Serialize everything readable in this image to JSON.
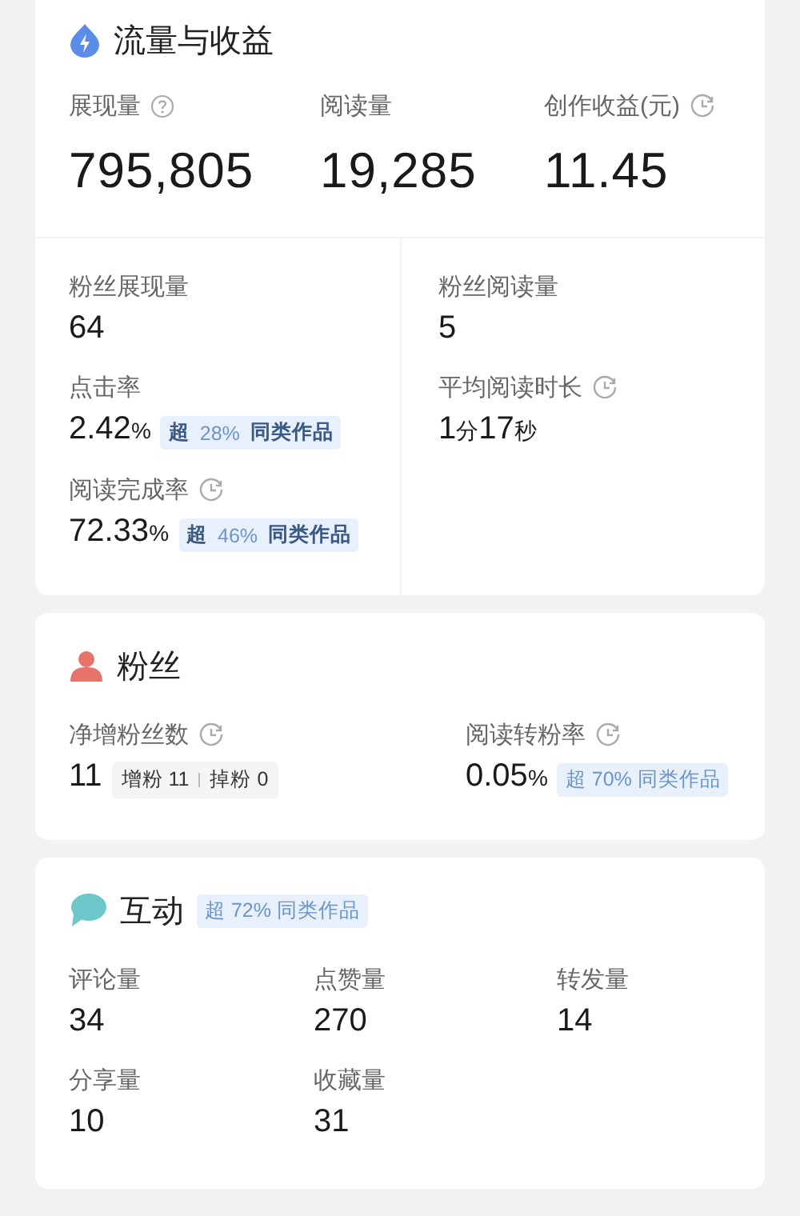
{
  "sections": [
    {
      "title": "流量与收益",
      "blocks": [
        {
          "kind": "headline",
          "items": [
            {
              "kind": "help",
              "label": "展现量",
              "value": "795,805"
            },
            {
              "kind": "plain",
              "label": "阅读量",
              "value": "19,285"
            },
            {
              "kind": "timed",
              "label": "创作收益(元)",
              "value": "11.45"
            }
          ]
        },
        {
          "kind": "split",
          "columns": [
            [
              {
                "kind": "plain",
                "label": "粉丝展现量",
                "value": "64"
              },
              {
                "kind": "plain",
                "label": "点击率",
                "value_parts": [
                  {
                    "text": "2.42",
                    "unit": false
                  },
                  {
                    "text": "%",
                    "unit": true
                  }
                ],
                "badge": "**超** 28% **同类作品**"
              },
              {
                "kind": "timed",
                "label": "阅读完成率",
                "value_parts": [
                  {
                    "text": "72.33",
                    "unit": false
                  },
                  {
                    "text": "%",
                    "unit": true
                  }
                ],
                "badge": "**超** 46% **同类作品**"
              }
            ],
            [
              {
                "kind": "plain",
                "label": "粉丝阅读量",
                "value": "5"
              },
              {
                "kind": "timed",
                "label": "平均阅读时长",
                "value_parts": [
                  {
                    "text": "1",
                    "unit": false
                  },
                  {
                    "text": "分",
                    "unit": true
                  },
                  {
                    "text": "17",
                    "unit": false
                  },
                  {
                    "text": "秒",
                    "unit": true
                  }
                ]
              }
            ]
          ]
        }
      ]
    },
    {
      "title": "粉丝",
      "blocks": [
        {
          "kind": "pair",
          "items": [
            {
              "kind": "timed",
              "label": "净增粉丝数",
              "value": "11",
              "breakdown": [
                {
                  "label": "增粉",
                  "value": "11"
                },
                {
                  "label": "掉粉",
                  "value": "0"
                }
              ]
            },
            {
              "kind": "timed",
              "label": "阅读转粉率",
              "value_parts": [
                {
                  "text": "0.05",
                  "unit": false
                },
                {
                  "text": "%",
                  "unit": true
                }
              ],
              "badge": "超 70% 同类作品"
            }
          ]
        }
      ]
    },
    {
      "title": "互动",
      "badge": "超 72% 同类作品",
      "blocks": [
        {
          "kind": "grid",
          "items": [
            {
              "kind": "plain",
              "label": "评论量",
              "value": "34"
            },
            {
              "kind": "plain",
              "label": "点赞量",
              "value": "270"
            },
            {
              "kind": "plain",
              "label": "转发量",
              "value": "14"
            },
            {
              "kind": "plain",
              "label": "分享量",
              "value": "10"
            },
            {
              "kind": "plain",
              "label": "收藏量",
              "value": "31"
            }
          ]
        }
      ]
    }
  ]
}
